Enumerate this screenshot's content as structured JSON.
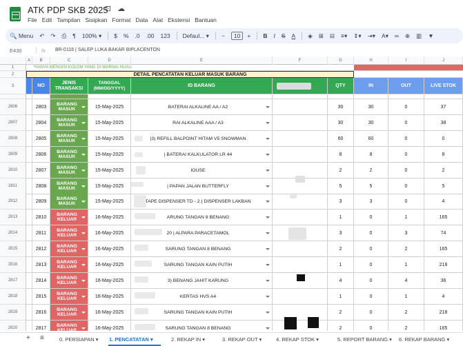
{
  "app": {
    "doc_title": "ATK PDP SKB 2025",
    "menu": [
      "File",
      "Edit",
      "Tampilan",
      "Sisipkan",
      "Format",
      "Data",
      "Alat",
      "Ekstensi",
      "Bantuan"
    ]
  },
  "toolbar": {
    "search": "Menu",
    "zoom": "100%",
    "currency": "$",
    "percent": "%",
    "dec_less": ".0",
    "dec_more": ".00",
    "number_fmt": "123",
    "font": "Defaul...",
    "font_size": "10",
    "bold": "B",
    "italic": "I",
    "strike": "S",
    "text_color": "A"
  },
  "formula_bar": {
    "cell_ref": "E430",
    "fx": "fx",
    "content": "BR-0116 | SALEP LUKA BAKAR BIPLACENTON"
  },
  "columns": [
    "A",
    "B",
    "C",
    "D",
    "E",
    "F",
    "G",
    "H",
    "I",
    "J"
  ],
  "sheet": {
    "note": "*HANYA MENGISI KOLOM YANG DI WARNAI HIJAU",
    "banner": "DETAIL PENCATATAN KELUAR MASUK BARANG",
    "headers": {
      "no": "NO",
      "jenis": "JENIS TRANSAKSI",
      "tanggal": "TANGGAL (MM/DD/YYYY)",
      "barang": "ID BARANG",
      "qty": "QTY",
      "in": "IN",
      "out": "OUT",
      "live": "LIVE STOK"
    },
    "header_row_nums": [
      "1",
      "2",
      "3"
    ],
    "rows": [
      {
        "rn": "2806",
        "no": "2803",
        "jenis": "BARANG MASUK",
        "tgl": "15-May-2025",
        "barang": "BATERAI ALKALINE AA / A2",
        "qty": "30",
        "in": "30",
        "out": "0",
        "live": "37"
      },
      {
        "rn": "2807",
        "no": "2804",
        "jenis": "BARANG MASUK",
        "tgl": "15-May-2025",
        "barang": "RAI ALKALINE AAA / A3",
        "qty": "30",
        "in": "30",
        "out": "0",
        "live": "38"
      },
      {
        "rn": "2808",
        "no": "2805",
        "jenis": "BARANG MASUK",
        "tgl": "15-May-2025",
        "barang": "|3) REFILL BALPOINT HITAM V5 SNOWMAN",
        "qty": "60",
        "in": "60",
        "out": "0",
        "live": "0"
      },
      {
        "rn": "2809",
        "no": "2806",
        "jenis": "BARANG MASUK",
        "tgl": "15-May-2025",
        "barang": "| BATERAI KALKULATOR LR 44",
        "qty": "8",
        "in": "8",
        "out": "0",
        "live": "8"
      },
      {
        "rn": "2810",
        "no": "2807",
        "jenis": "BARANG MASUK",
        "tgl": "15-May-2025",
        "barang": "IOUSE",
        "qty": "2",
        "in": "2",
        "out": "0",
        "live": "2"
      },
      {
        "rn": "2811",
        "no": "2808",
        "jenis": "BARANG MASUK",
        "tgl": "15-May-2025",
        "barang": "| PAPAN JALAN BUTTERFLY",
        "qty": "5",
        "in": "5",
        "out": "0",
        "live": "5"
      },
      {
        "rn": "2812",
        "no": "2809",
        "jenis": "BARANG MASUK",
        "tgl": "15-May-2025",
        "barang": "TAPE DISPENSER TD - 2 ( DISPENSER LAKBAN",
        "qty": "3",
        "in": "3",
        "out": "0",
        "live": "4"
      },
      {
        "rn": "2813",
        "no": "2810",
        "jenis": "BARANG KELUAR",
        "tgl": "16-May-2025",
        "barang": "ARUNG TANGAN 8 BENANG",
        "qty": "1",
        "in": "0",
        "out": "1",
        "live": "165"
      },
      {
        "rn": "2814",
        "no": "2811",
        "jenis": "BARANG KELUAR",
        "tgl": "16-May-2025",
        "barang": "20 | ALPARA PARACETAMOL",
        "qty": "3",
        "in": "0",
        "out": "3",
        "live": "74"
      },
      {
        "rn": "2815",
        "no": "2812",
        "jenis": "BARANG KELUAR",
        "tgl": "16-May-2025",
        "barang": "SARUNG TANGAN 8 BENANG",
        "qty": "2",
        "in": "0",
        "out": "2",
        "live": "165"
      },
      {
        "rn": "2816",
        "no": "2813",
        "jenis": "BARANG KELUAR",
        "tgl": "16-May-2025",
        "barang": "SARUNG TANGAN KAIN PUTIH",
        "qty": "1",
        "in": "0",
        "out": "1",
        "live": "218"
      },
      {
        "rn": "2817",
        "no": "2814",
        "jenis": "BARANG KELUAR",
        "tgl": "16-May-2025",
        "barang": "3) BENANG JAHIT KARUNG",
        "qty": "4",
        "in": "0",
        "out": "4",
        "live": "36"
      },
      {
        "rn": "2818",
        "no": "2815",
        "jenis": "BARANG KELUAR",
        "tgl": "16-May-2025",
        "barang": "KERTAS HVS A4",
        "qty": "1",
        "in": "0",
        "out": "1",
        "live": "4"
      },
      {
        "rn": "2819",
        "no": "2816",
        "jenis": "BARANG KELUAR",
        "tgl": "16-May-2025",
        "barang": "SARUNG TANGAN KAIN PUTIH",
        "qty": "2",
        "in": "0",
        "out": "2",
        "live": "218"
      },
      {
        "rn": "2820",
        "no": "2817",
        "jenis": "BARANG KELUAR",
        "tgl": "16-May-2025",
        "barang": "SARUNG TANGAN 8 BENANG",
        "qty": "2",
        "in": "0",
        "out": "2",
        "live": "165"
      }
    ]
  },
  "tabs": [
    "0. PERSIAPAN",
    "1. PENCATATAN",
    "2. REKAP IN",
    "3. REKAP OUT",
    "4. REKAP STOK",
    "5. REPORT BARANG",
    "6. REKAP BARANG"
  ],
  "colors": {
    "header_blue": "#4a86e8",
    "masuk_green": "#6aa84f",
    "keluar_red": "#e06666",
    "banner_yellow": "#fff2cc",
    "accent_red": "#e06666"
  }
}
